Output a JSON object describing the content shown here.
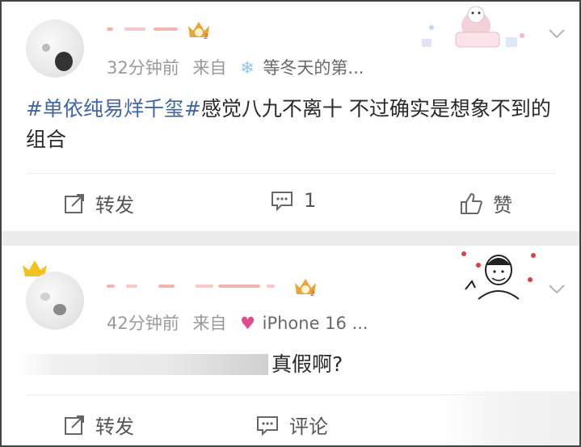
{
  "posts": [
    {
      "time": "32分钟前",
      "source_prefix": "来自",
      "source_name": "等冬天的第...",
      "source_icon": "snowflake-icon",
      "content_topic": "#单依纯易烊千玺#",
      "content_text": "感觉八九不离十 不过确实是想象不到的组合",
      "actions": {
        "repost_label": "转发",
        "comment_label": "1",
        "like_label": "赞"
      }
    },
    {
      "time": "42分钟前",
      "source_prefix": "来自",
      "source_name": "iPhone 16 ...",
      "source_icon": "heart-icon",
      "content_text": "真假啊?",
      "actions": {
        "repost_label": "转发",
        "comment_label": "评论"
      }
    }
  ],
  "colors": {
    "topic": "#3f66a7",
    "meta": "#9a9a9a",
    "separator": "#ececec",
    "badge_gold": "#e9a53a"
  }
}
